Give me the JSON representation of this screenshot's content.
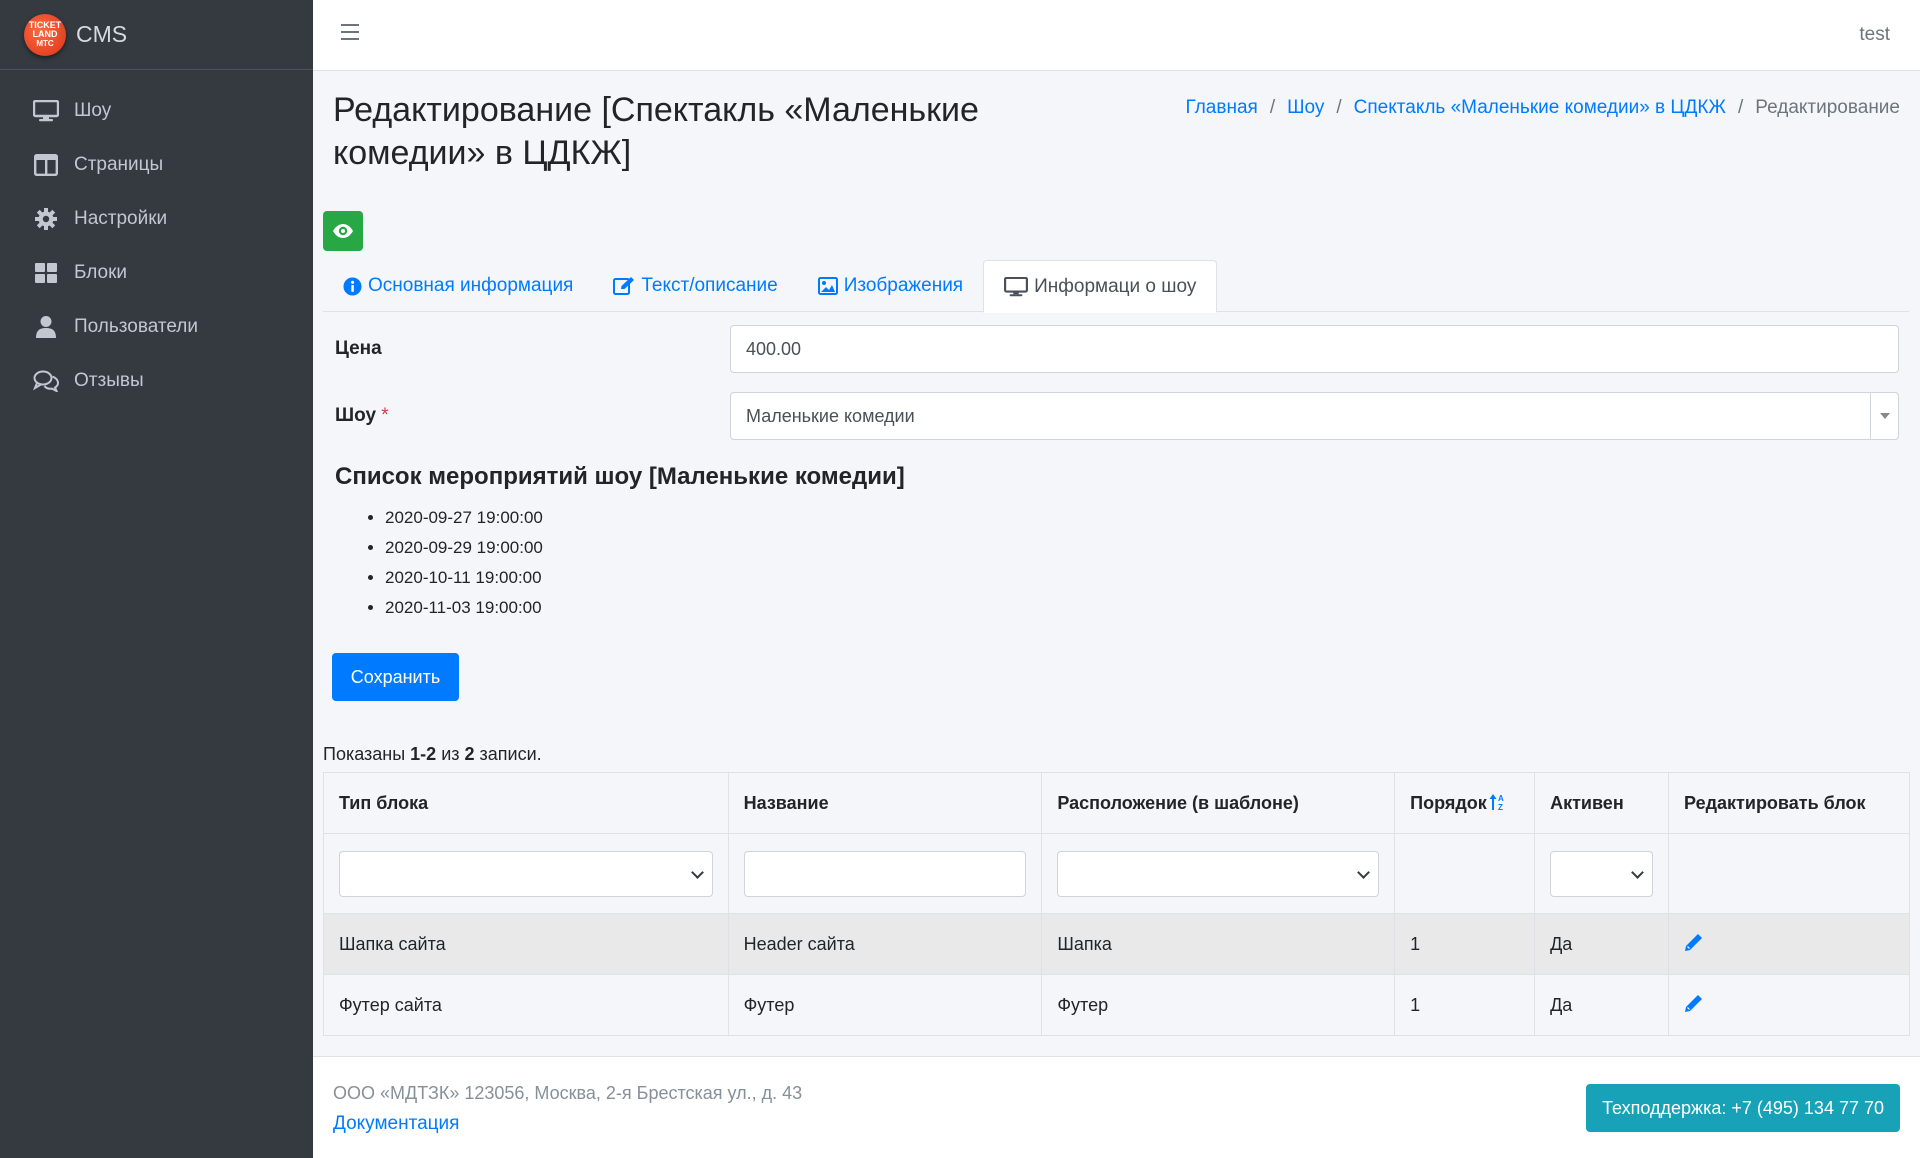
{
  "brand": {
    "logo_lines": [
      "TICKET",
      "LAND",
      "МТС"
    ],
    "name": "CMS"
  },
  "sidebar": {
    "items": [
      {
        "label": "Шоу",
        "icon": "monitor-icon"
      },
      {
        "label": "Страницы",
        "icon": "columns-icon"
      },
      {
        "label": "Настройки",
        "icon": "gear-icon"
      },
      {
        "label": "Блоки",
        "icon": "grid-icon"
      },
      {
        "label": "Пользователи",
        "icon": "user-icon"
      },
      {
        "label": "Отзывы",
        "icon": "comments-icon"
      }
    ]
  },
  "topbar": {
    "user": "test"
  },
  "page": {
    "title": "Редактирование [Спектакль «Маленькие комедии» в ЦДКЖ]",
    "breadcrumb": [
      "Главная",
      "Шоу",
      "Спектакль «Маленькие комедии» в ЦДКЖ",
      "Редактирование"
    ]
  },
  "tabs": [
    {
      "label": "Основная информация",
      "icon": "info-circle-icon",
      "active": false
    },
    {
      "label": "Текст/описание",
      "icon": "edit-icon",
      "active": false
    },
    {
      "label": "Изображения",
      "icon": "image-icon",
      "active": false
    },
    {
      "label": "Информаци о шоу",
      "icon": "monitor-icon",
      "active": true
    }
  ],
  "form": {
    "price_label": "Цена",
    "price_value": "400.00",
    "show_label": "Шоу",
    "show_required_mark": "*",
    "show_value": "Маленькие комедии"
  },
  "events": {
    "title": "Список мероприятий шоу [Маленькие комедии]",
    "items": [
      "2020-09-27 19:00:00",
      "2020-09-29 19:00:00",
      "2020-10-11 19:00:00",
      "2020-11-03 19:00:00"
    ]
  },
  "save_label": "Сохранить",
  "summary": {
    "prefix": "Показаны ",
    "range": "1-2",
    "middle": " из ",
    "total": "2",
    "suffix": " записи."
  },
  "table": {
    "headers": [
      "Тип блока",
      "Название",
      "Расположение (в шаблоне)",
      "Порядок",
      "Активен",
      "Редактировать блок"
    ],
    "rows": [
      [
        "Шапка сайта",
        "Header сайта",
        "Шапка",
        "1",
        "Да"
      ],
      [
        "Футер сайта",
        "Футер",
        "Футер",
        "1",
        "Да"
      ]
    ]
  },
  "footer": {
    "address": "ООО «МДТЗК» 123056, Москва, 2-я Брестская ул., д. 43",
    "doc_link": "Документация",
    "support": "Техподдержка: +7 (495) 134 77 70"
  },
  "colors": {
    "sidebar_bg": "#343a40",
    "primary": "#007bff",
    "success": "#28a745",
    "info": "#17a2b8"
  }
}
